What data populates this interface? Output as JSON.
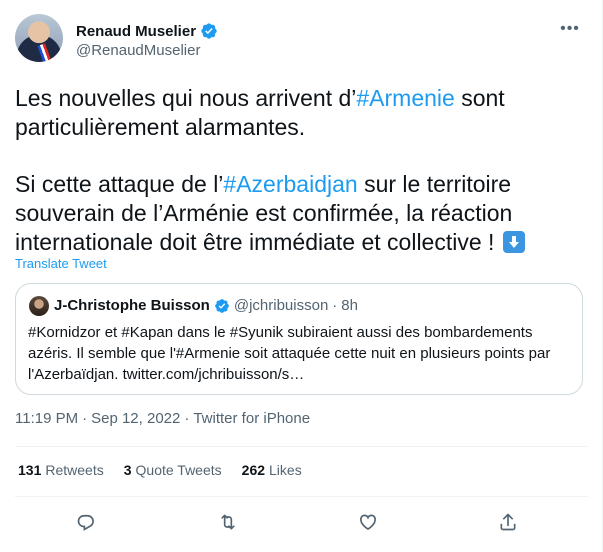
{
  "author": {
    "name": "Renaud Muselier",
    "handle": "@RenaudMuselier"
  },
  "tweet": {
    "para1": [
      {
        "text": "Les nouvelles qui nous arrivent d’",
        "tag": false
      },
      {
        "text": "#Armenie",
        "tag": true
      },
      {
        "text": " sont particulièrement alarmantes.",
        "tag": false
      }
    ],
    "para2": [
      {
        "text": "Si cette attaque de l’",
        "tag": false
      },
      {
        "text": "#Azerbaidjan",
        "tag": true
      },
      {
        "text": " sur le territoire souverain de l’Arménie est confirmée, la réaction internationale doit être immédiate et collective !",
        "tag": false
      }
    ],
    "emoji": "down-arrow-icon",
    "translate_label": "Translate Tweet"
  },
  "quote": {
    "name": "J-Christophe Buisson",
    "handle": "@jchribuisson",
    "separator": "·",
    "time": "8h",
    "text": "#Kornidzor et #Kapan dans le #Syunik subiraient aussi des bombardements azéris. Il semble que l'#Armenie soit attaquée cette nuit en plusieurs points par l'Azerbaïdjan. twitter.com/jchribuisson/s…"
  },
  "meta": {
    "time": "11:19 PM",
    "date": "Sep 12, 2022",
    "sep1": "·",
    "sep2": "·",
    "source": "Twitter for iPhone"
  },
  "stats": {
    "retweets": {
      "count": "131",
      "label": "Retweets"
    },
    "quotes": {
      "count": "3",
      "label": "Quote Tweets"
    },
    "likes": {
      "count": "262",
      "label": "Likes"
    }
  },
  "colors": {
    "accent": "#1d9bf0",
    "secondary_text": "#536471"
  },
  "actions": [
    "reply-icon",
    "retweet-icon",
    "like-icon",
    "share-icon"
  ]
}
